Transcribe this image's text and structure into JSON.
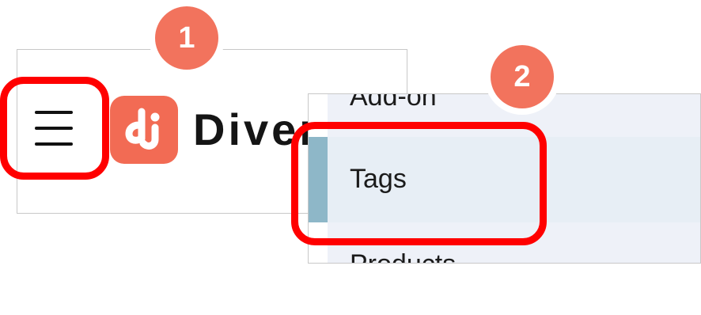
{
  "callouts": {
    "step1": "1",
    "step2": "2"
  },
  "header": {
    "menu_icon": "hamburger-menu-icon",
    "logo_icon": "dj-logo-icon",
    "brand_text": "Diver"
  },
  "sidebar": {
    "items": [
      {
        "label": "Add-on",
        "active": false
      },
      {
        "label": "Tags",
        "active": true
      },
      {
        "label": "Products",
        "active": false
      }
    ]
  },
  "colors": {
    "badge": "#f2735d",
    "highlight": "#ff0000",
    "logo": "#f26b54",
    "active_indicator": "#8eb7c8",
    "sidebar_bg": "#eef1f8"
  }
}
